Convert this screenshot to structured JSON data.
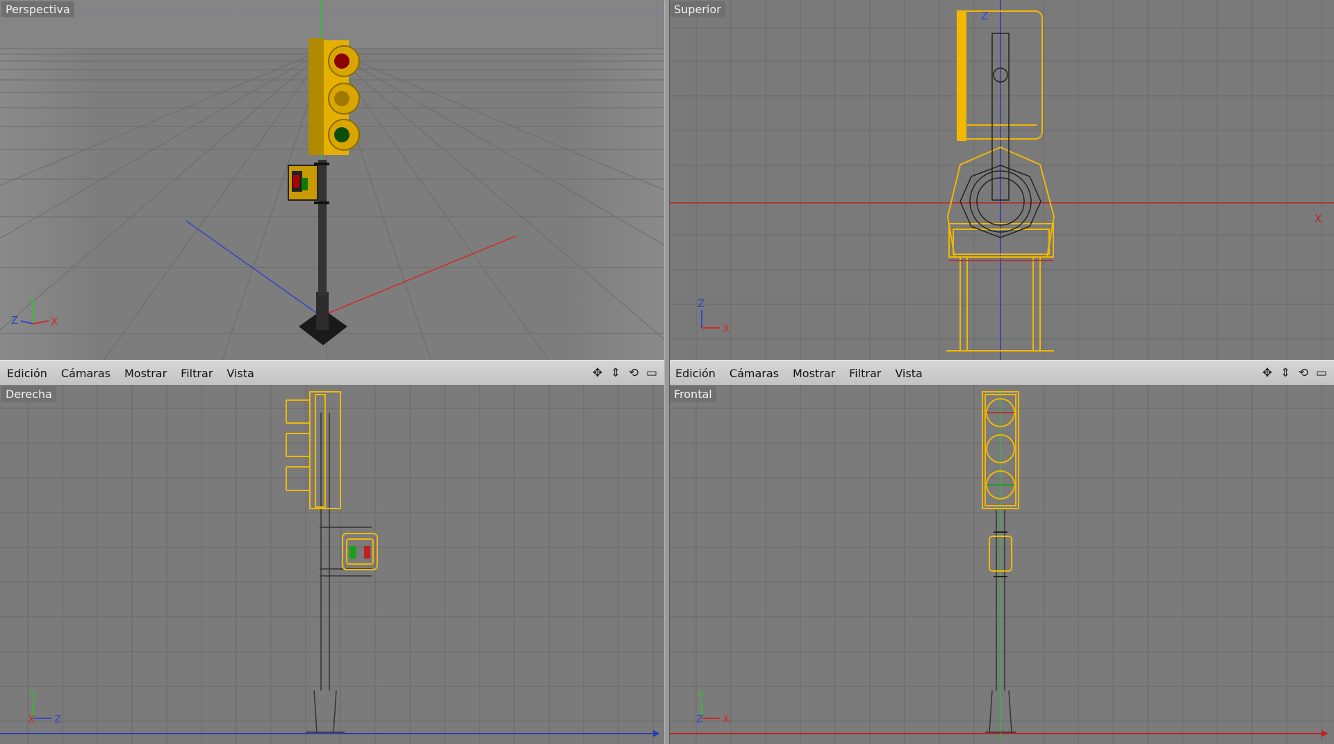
{
  "viewports": {
    "perspective": {
      "label": "Perspectiva"
    },
    "top": {
      "label": "Superior"
    },
    "right": {
      "label": "Derecha"
    },
    "front": {
      "label": "Frontal"
    }
  },
  "menus": [
    "Edición",
    "Cámaras",
    "Mostrar",
    "Filtrar",
    "Vista"
  ],
  "axes": {
    "x": "X",
    "y": "Y",
    "z": "Z"
  },
  "colors": {
    "x_axis": "#d42a2a",
    "y_axis": "#2fbf2f",
    "z_axis": "#3446c9",
    "wire": "#f2b800"
  },
  "toolbar_icons": [
    "move-view-icon",
    "dolly-view-icon",
    "rotate-view-icon",
    "maximize-view-icon"
  ]
}
